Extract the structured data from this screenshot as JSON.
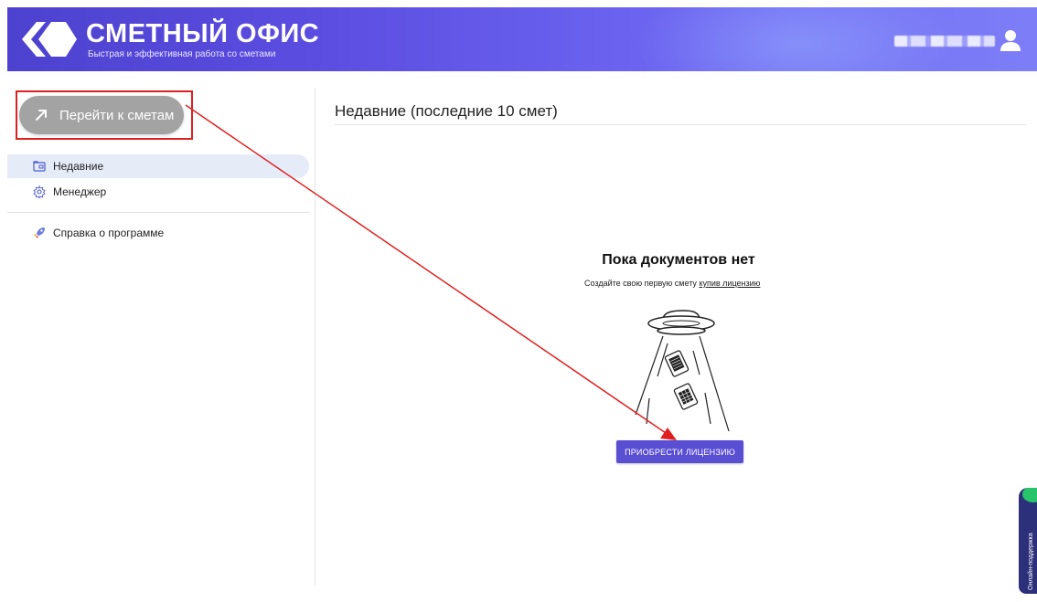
{
  "header": {
    "brand_title": "СМЕТНЫЙ ОФИС",
    "brand_subtitle": "Быстрая и эффективная работа со сметами",
    "accent_color": "#5b4de0"
  },
  "sidebar": {
    "goto_button_label": "Перейти к сметам",
    "items": [
      {
        "label": "Недавние",
        "icon": "folder-icon",
        "active": true
      },
      {
        "label": "Менеджер",
        "icon": "gear-icon",
        "active": false
      },
      {
        "label": "Справка о программе",
        "icon": "rocket-icon",
        "active": false
      }
    ]
  },
  "main": {
    "title": "Недавние (последние 10 смет)",
    "empty_title": "Пока документов нет",
    "empty_subtitle_prefix": "Создайте свою первую смету",
    "empty_subtitle_link": "купив лицензию",
    "buy_button_label": "ПРИОБРЕСТИ ЛИЦЕНЗИЮ",
    "buy_button_color": "#5a4ed3"
  },
  "support": {
    "label": "Онлайн-поддержка"
  },
  "annotation": {
    "color": "#e02020"
  }
}
